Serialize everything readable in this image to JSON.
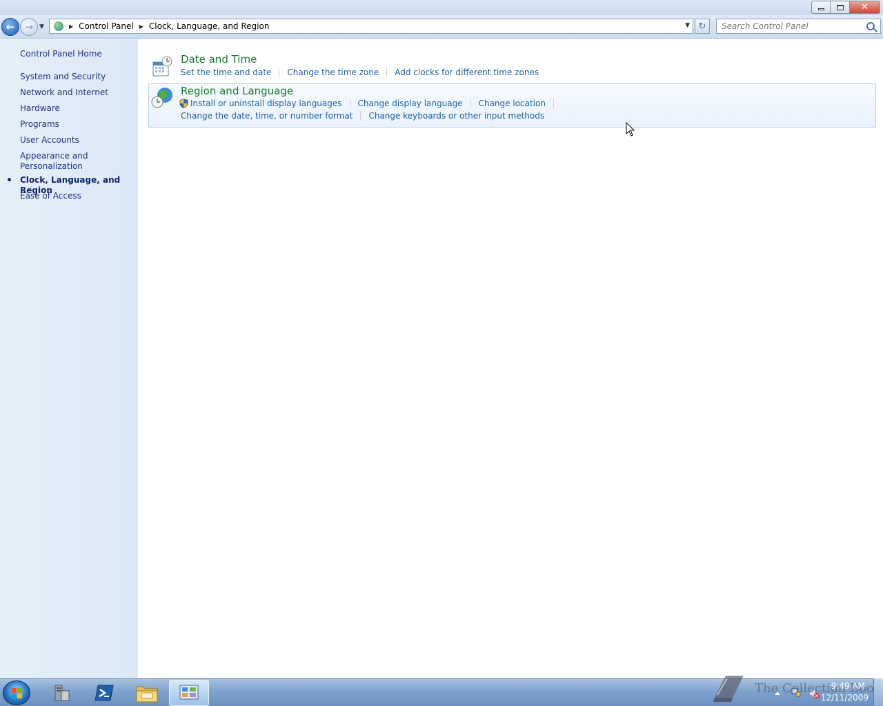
{
  "window": {
    "minimize_icon": "minimize-icon",
    "maximize_icon": "restore-icon",
    "close_label": "✕"
  },
  "nav": {
    "back_icon": "back-arrow-icon",
    "forward_icon": "forward-arrow-icon",
    "breadcrumb": [
      "Control Panel",
      "Clock, Language, and Region"
    ],
    "search_placeholder": "Search Control Panel"
  },
  "sidebar": {
    "home": "Control Panel Home",
    "items": [
      {
        "label": "System and Security"
      },
      {
        "label": "Network and Internet"
      },
      {
        "label": "Hardware"
      },
      {
        "label": "Programs"
      },
      {
        "label": "User Accounts"
      },
      {
        "label": "Appearance and Personalization"
      },
      {
        "label": "Clock, Language, and Region",
        "current": true
      },
      {
        "label": "Ease of Access"
      }
    ]
  },
  "categories": [
    {
      "title": "Date and Time",
      "icon": "calendar-clock-icon",
      "tasks_row1": [
        "Set the time and date",
        "Change the time zone",
        "Add clocks for different time zones"
      ],
      "tasks_row2": []
    },
    {
      "title": "Region and Language",
      "icon": "globe-clock-icon",
      "tasks_row1": [
        "Install or uninstall display languages",
        "Change display language",
        "Change location"
      ],
      "tasks_row2": [
        "Change the date, time, or number format",
        "Change keyboards or other input methods"
      ]
    }
  ],
  "taskbar": {
    "items": [
      "server-manager-icon",
      "powershell-icon",
      "file-explorer-icon",
      "control-panel-icon"
    ],
    "active_index": 3,
    "clock_time": "9:49 AM",
    "clock_date": "12/11/2009"
  },
  "watermark": {
    "text": "The Collection Book"
  },
  "colors": {
    "link": "#1c5fa7",
    "category_title": "#1a7a2b",
    "sidebar_link": "#1e3287",
    "sidebar_bg": "#dde9f6"
  }
}
